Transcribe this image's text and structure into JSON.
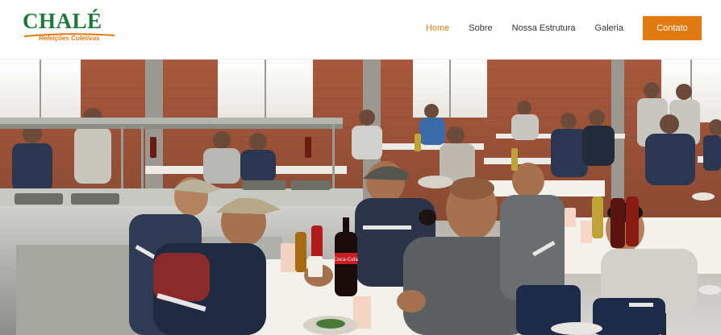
{
  "brand": {
    "name": "CHALÉ",
    "tagline": "Refeições Coletivas",
    "colors": {
      "primary_green": "#1f7a3a",
      "accent_orange": "#e07b14"
    }
  },
  "nav": {
    "items": [
      {
        "label": "Home",
        "active": true
      },
      {
        "label": "Sobre",
        "active": false
      },
      {
        "label": "Nossa Estrutura",
        "active": false
      },
      {
        "label": "Galeria",
        "active": false
      }
    ],
    "cta_label": "Contato"
  },
  "hero": {
    "can_label": "Coca-Cola"
  }
}
